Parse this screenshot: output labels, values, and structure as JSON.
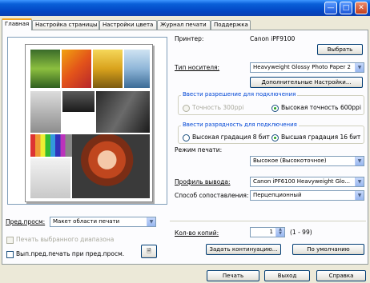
{
  "tabs": [
    {
      "label": "Главная"
    },
    {
      "label": "Настройка страницы"
    },
    {
      "label": "Настройки цвета"
    },
    {
      "label": "Журнал печати"
    },
    {
      "label": "Поддержка"
    }
  ],
  "printer": {
    "label": "Принтер:",
    "value": "Canon iPF9100",
    "select_button": "Выбрать"
  },
  "media": {
    "label": "Тип носителя:",
    "value": "Heavyweight Glossy Photo Paper 2",
    "advanced_button": "Дополнительные Настройки..."
  },
  "resolution_group": {
    "title": "Ввести разрешение для подключения",
    "option_low": "Точность 300ppi",
    "option_high": "Высокая точность 600ppi"
  },
  "gradation_group": {
    "title": "Ввести разрядность для подключения",
    "option_8bit": "Высокая градация 8 бит",
    "option_16bit": "Высшая градация 16 бит"
  },
  "print_mode": {
    "label": "Режим печати:",
    "value": "Высокое (Высокоточное)"
  },
  "output_profile": {
    "label": "Профиль вывода:",
    "value": "Canon iPF6100 Heavyweight Glo..."
  },
  "matching": {
    "label": "Способ сопоставления:",
    "value": "Перцепционный"
  },
  "preview_mode": {
    "label": "Пред.просм:",
    "value": "Макет области печати"
  },
  "print_selected": {
    "label": "Печать выбранного диапазона"
  },
  "print_after_preview": {
    "label": "Вып.пред.печать при пред.просм."
  },
  "copies": {
    "label": "Кол-во копий:",
    "value": "1",
    "range": "(1 - 99)"
  },
  "buttons": {
    "set_contents": "Задать континуацию...",
    "defaults": "По умолчанию",
    "print": "Печать",
    "exit": "Выход",
    "help": "Справка"
  },
  "colors": {
    "accent": "#0046d5",
    "titlebar": "#0246c4"
  }
}
